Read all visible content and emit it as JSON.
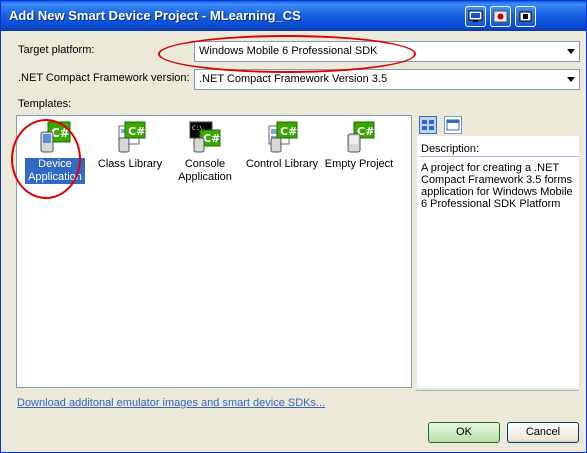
{
  "window": {
    "title": "Add New Smart Device Project - MLearning_CS"
  },
  "form": {
    "target_platform_label": "Target platform:",
    "target_platform_value": "Windows Mobile 6 Professional SDK",
    "framework_label": ".NET Compact Framework version:",
    "framework_value": ".NET Compact Framework Version 3.5",
    "templates_label": "Templates:"
  },
  "templates": [
    {
      "line1": "Device",
      "line2": "Application",
      "icon": "device-application-icon",
      "selected": true
    },
    {
      "line1": "Class Library",
      "line2": "",
      "icon": "class-library-icon",
      "selected": false
    },
    {
      "line1": "Console",
      "line2": "Application",
      "icon": "console-application-icon",
      "selected": false
    },
    {
      "line1": "Control Library",
      "line2": "",
      "icon": "control-library-icon",
      "selected": false
    },
    {
      "line1": "Empty Project",
      "line2": "",
      "icon": "empty-project-icon",
      "selected": false
    }
  ],
  "description": {
    "title": "Description:",
    "text": "A project for creating a .NET Compact Framework 3.5 forms application for Windows Mobile 6 Professional SDK Platform"
  },
  "footer": {
    "download_link": "Download additonal emulator images and smart device SDKs...",
    "ok_label": "OK",
    "cancel_label": "Cancel"
  },
  "colors": {
    "annotation": "#e00000",
    "titlebar": "#0a4fd6",
    "selection": "#316ac5",
    "csharp_badge": "#3aa800"
  }
}
